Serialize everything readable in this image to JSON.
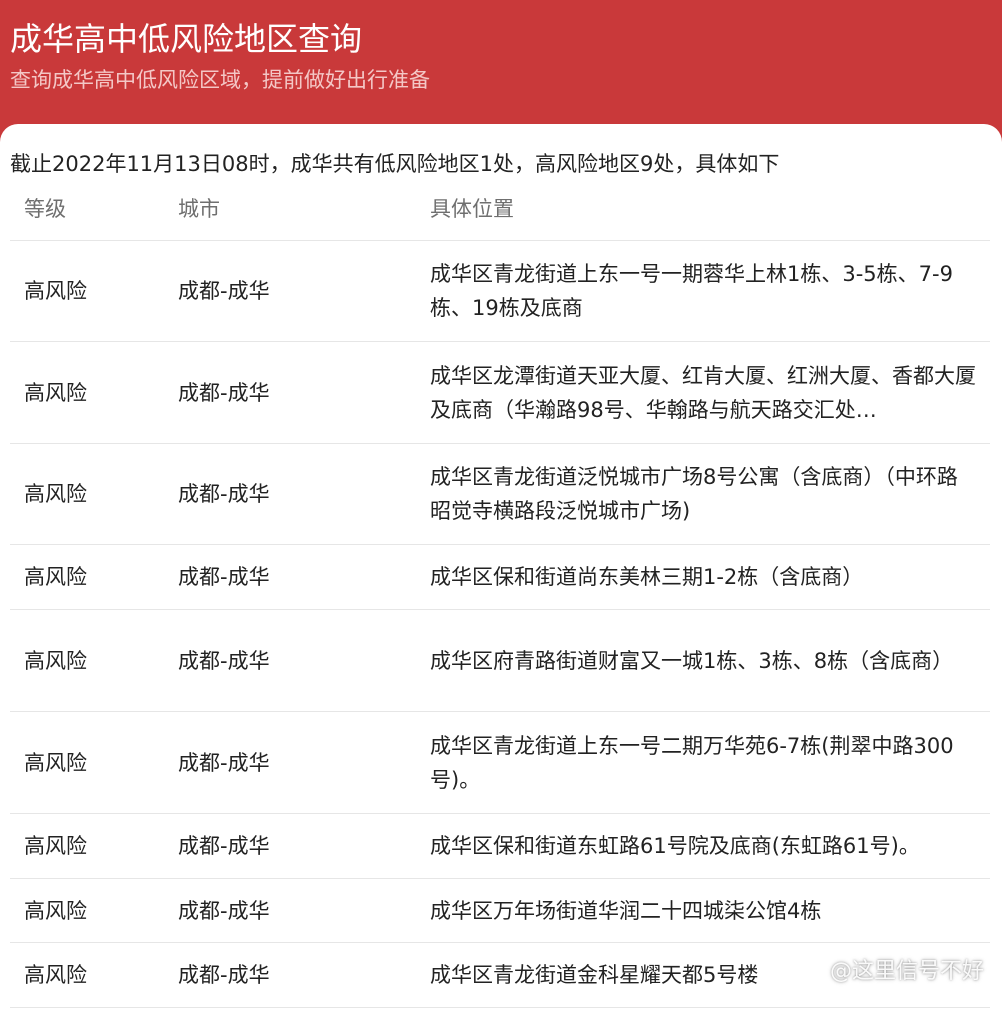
{
  "header": {
    "title": "成华高中低风险地区查询",
    "subtitle": "查询成华高中低风险区域，提前做好出行准备"
  },
  "summary": "截止2022年11月13日08时，成华共有低风险地区1处，高风险地区9处，具体如下",
  "table": {
    "columns": [
      "等级",
      "城市",
      "具体位置"
    ],
    "rows": [
      {
        "level": "高风险",
        "city": "成都-成华",
        "location": "成华区青龙街道上东一号一期蓉华上林1栋、3-5栋、7-9栋、19栋及底商"
      },
      {
        "level": "高风险",
        "city": "成都-成华",
        "location": "成华区龙潭街道天亚大厦、红肯大厦、红洲大厦、香都大厦及底商（华瀚路98号、华翰路与航天路交汇处…"
      },
      {
        "level": "高风险",
        "city": "成都-成华",
        "location": "成华区青龙街道泛悦城市广场8号公寓（含底商）（中环路昭觉寺横路段泛悦城市广场)"
      },
      {
        "level": "高风险",
        "city": "成都-成华",
        "location": "成华区保和街道尚东美林三期1-2栋（含底商）"
      },
      {
        "level": "高风险",
        "city": "成都-成华",
        "location": "成华区府青路街道财富又一城1栋、3栋、8栋（含底商）"
      },
      {
        "level": "高风险",
        "city": "成都-成华",
        "location": "成华区青龙街道上东一号二期万华苑6-7栋(荆翠中路300号)。"
      },
      {
        "level": "高风险",
        "city": "成都-成华",
        "location": "成华区保和街道东虹路61号院及底商(东虹路61号)。"
      },
      {
        "level": "高风险",
        "city": "成都-成华",
        "location": "成华区万年场街道华润二十四城柒公馆4栋"
      },
      {
        "level": "高风险",
        "city": "成都-成华",
        "location": "成华区青龙街道金科星耀天都5号楼"
      }
    ]
  },
  "watermark": "@这里信号不好",
  "colors": {
    "header_bg": "#c9393a",
    "card_bg": "#ffffff",
    "text": "#222222",
    "muted": "#6f6f6f",
    "divider": "#e6e6e6"
  }
}
